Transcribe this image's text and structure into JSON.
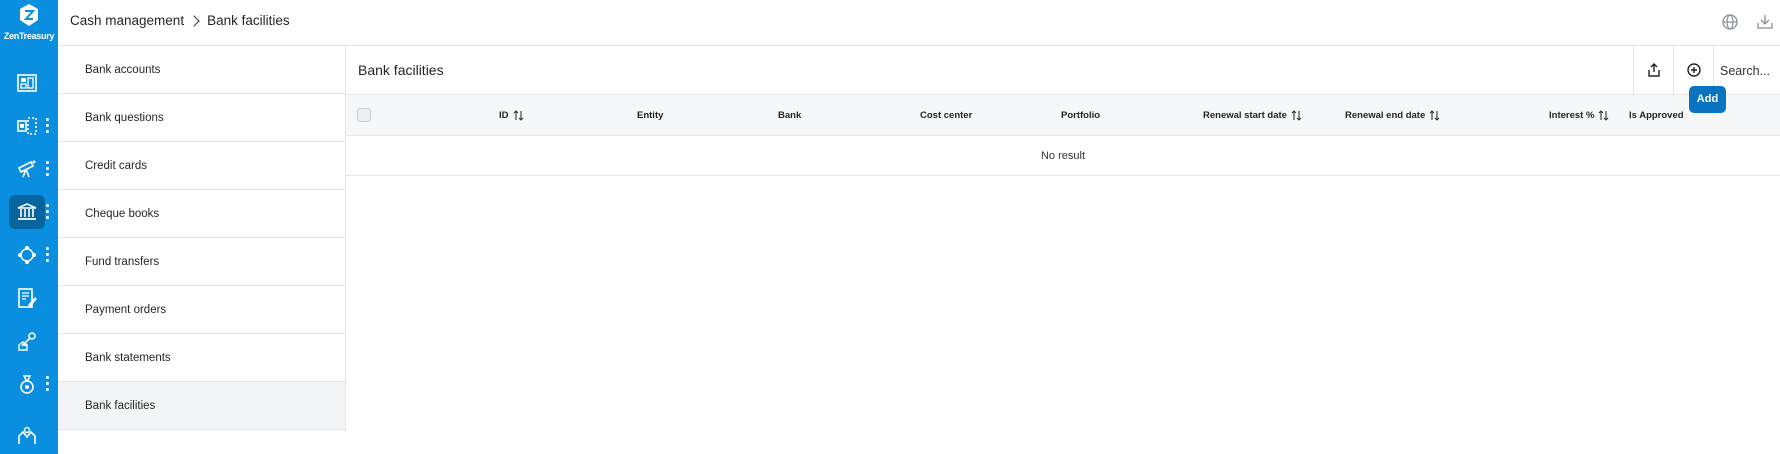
{
  "app": {
    "name": "ZenTreasury",
    "brand_color": "#0a8fe0",
    "accent_color": "#0a73c2"
  },
  "rail": {
    "items": [
      {
        "icon": "dashboard-icon",
        "has_menu": false
      },
      {
        "icon": "cash-flow-icon",
        "has_menu": true
      },
      {
        "icon": "forecast-telescope-icon",
        "has_menu": true
      },
      {
        "icon": "bank-icon",
        "has_menu": true,
        "active": true
      },
      {
        "icon": "network-icon",
        "has_menu": true
      },
      {
        "icon": "document-edit-icon",
        "has_menu": false
      },
      {
        "icon": "key-house-icon",
        "has_menu": false
      },
      {
        "icon": "money-bag-icon",
        "has_menu": true
      },
      {
        "icon": "hands-icon",
        "has_menu": false
      }
    ]
  },
  "breadcrumb": {
    "parent": "Cash management",
    "current": "Bank facilities"
  },
  "topbar": {
    "icons": [
      "globe-icon",
      "download-icon"
    ]
  },
  "subnav": {
    "items": [
      {
        "label": "Bank accounts"
      },
      {
        "label": "Bank questions"
      },
      {
        "label": "Credit cards"
      },
      {
        "label": "Cheque books"
      },
      {
        "label": "Fund transfers"
      },
      {
        "label": "Payment orders"
      },
      {
        "label": "Bank statements"
      },
      {
        "label": "Bank facilities",
        "active": true
      }
    ]
  },
  "main": {
    "title": "Bank facilities",
    "search_placeholder": "Search...",
    "add_tooltip": "Add",
    "columns": [
      {
        "label": "ID",
        "sortable": true
      },
      {
        "label": "Entity",
        "sortable": false
      },
      {
        "label": "Bank",
        "sortable": false
      },
      {
        "label": "Cost center",
        "sortable": false
      },
      {
        "label": "Portfolio",
        "sortable": false
      },
      {
        "label": "Renewal start date",
        "sortable": true
      },
      {
        "label": "Renewal end date",
        "sortable": true
      },
      {
        "label": "Interest %",
        "sortable": true
      },
      {
        "label": "Is Approved",
        "sortable": false
      }
    ],
    "rows": [],
    "empty_text": "No result"
  }
}
